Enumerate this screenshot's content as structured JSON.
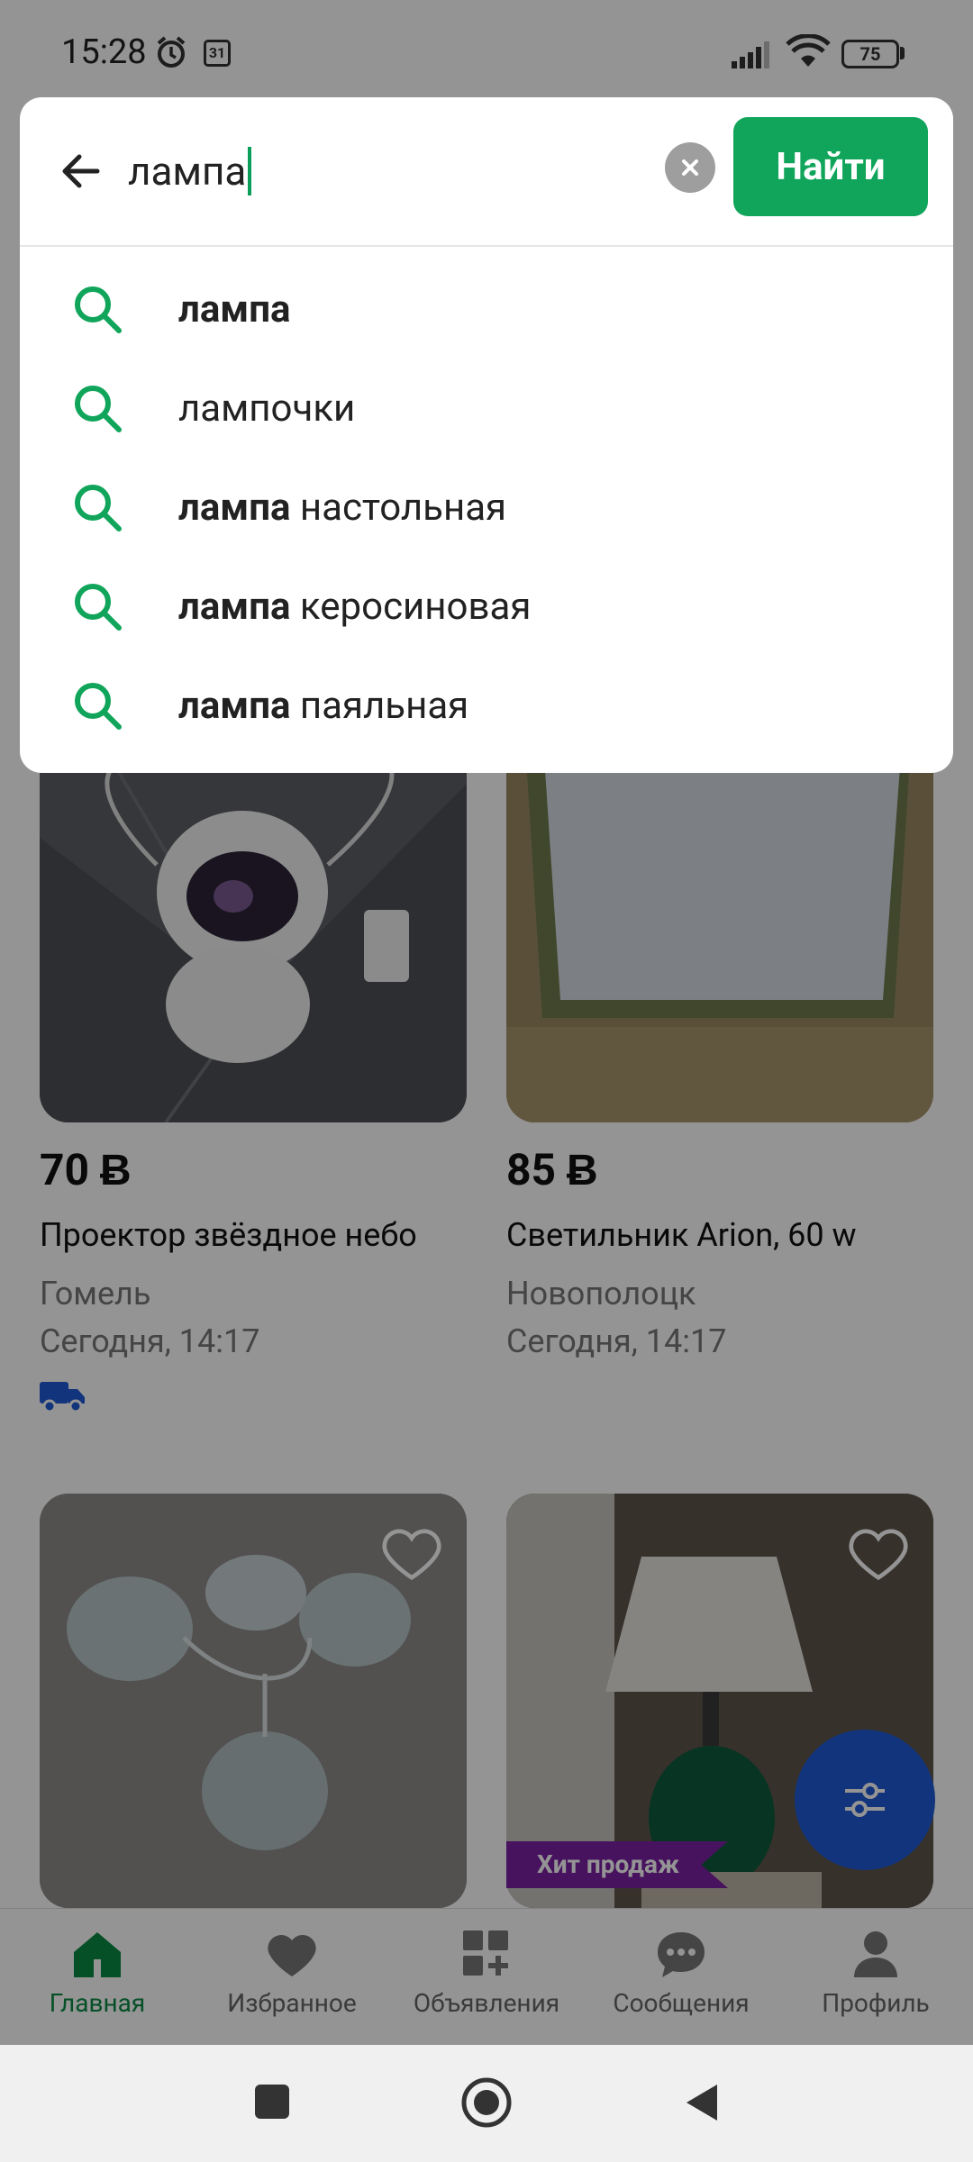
{
  "status_bar": {
    "time": "15:28",
    "calendar_day": "31",
    "battery": "75"
  },
  "search": {
    "query": "лампа",
    "find_label": "Найти",
    "suggestions": [
      {
        "bold": "лампа",
        "rest": ""
      },
      {
        "bold": "",
        "rest": "лампочки"
      },
      {
        "bold": "лампа",
        "rest": " настольная"
      },
      {
        "bold": "лампа",
        "rest": " керосиновая"
      },
      {
        "bold": "лампа",
        "rest": " паяльная"
      }
    ]
  },
  "listings": [
    {
      "price": "70 Ƀ",
      "title": "Проектор звёздное небо",
      "city": "Гомель",
      "date": "Сегодня, 14:17",
      "delivery": true
    },
    {
      "price": "85 Ƀ",
      "title": "Светильник Arion, 60 w",
      "city": "Новополоцк",
      "date": "Сегодня, 14:17",
      "delivery": false
    },
    {
      "badge": ""
    },
    {
      "badge": "Хит продаж"
    }
  ],
  "bottom_nav": [
    {
      "label": "Главная",
      "icon": "home-icon",
      "active": true
    },
    {
      "label": "Избранное",
      "icon": "heart-icon",
      "active": false
    },
    {
      "label": "Объявления",
      "icon": "grid-plus-icon",
      "active": false
    },
    {
      "label": "Сообщения",
      "icon": "chat-icon",
      "active": false
    },
    {
      "label": "Профиль",
      "icon": "person-icon",
      "active": false
    }
  ],
  "colors": {
    "accent": "#10a55a",
    "active_nav": "#0b8a45",
    "fab": "#1e5bd6",
    "badge": "#7b1fa2"
  }
}
